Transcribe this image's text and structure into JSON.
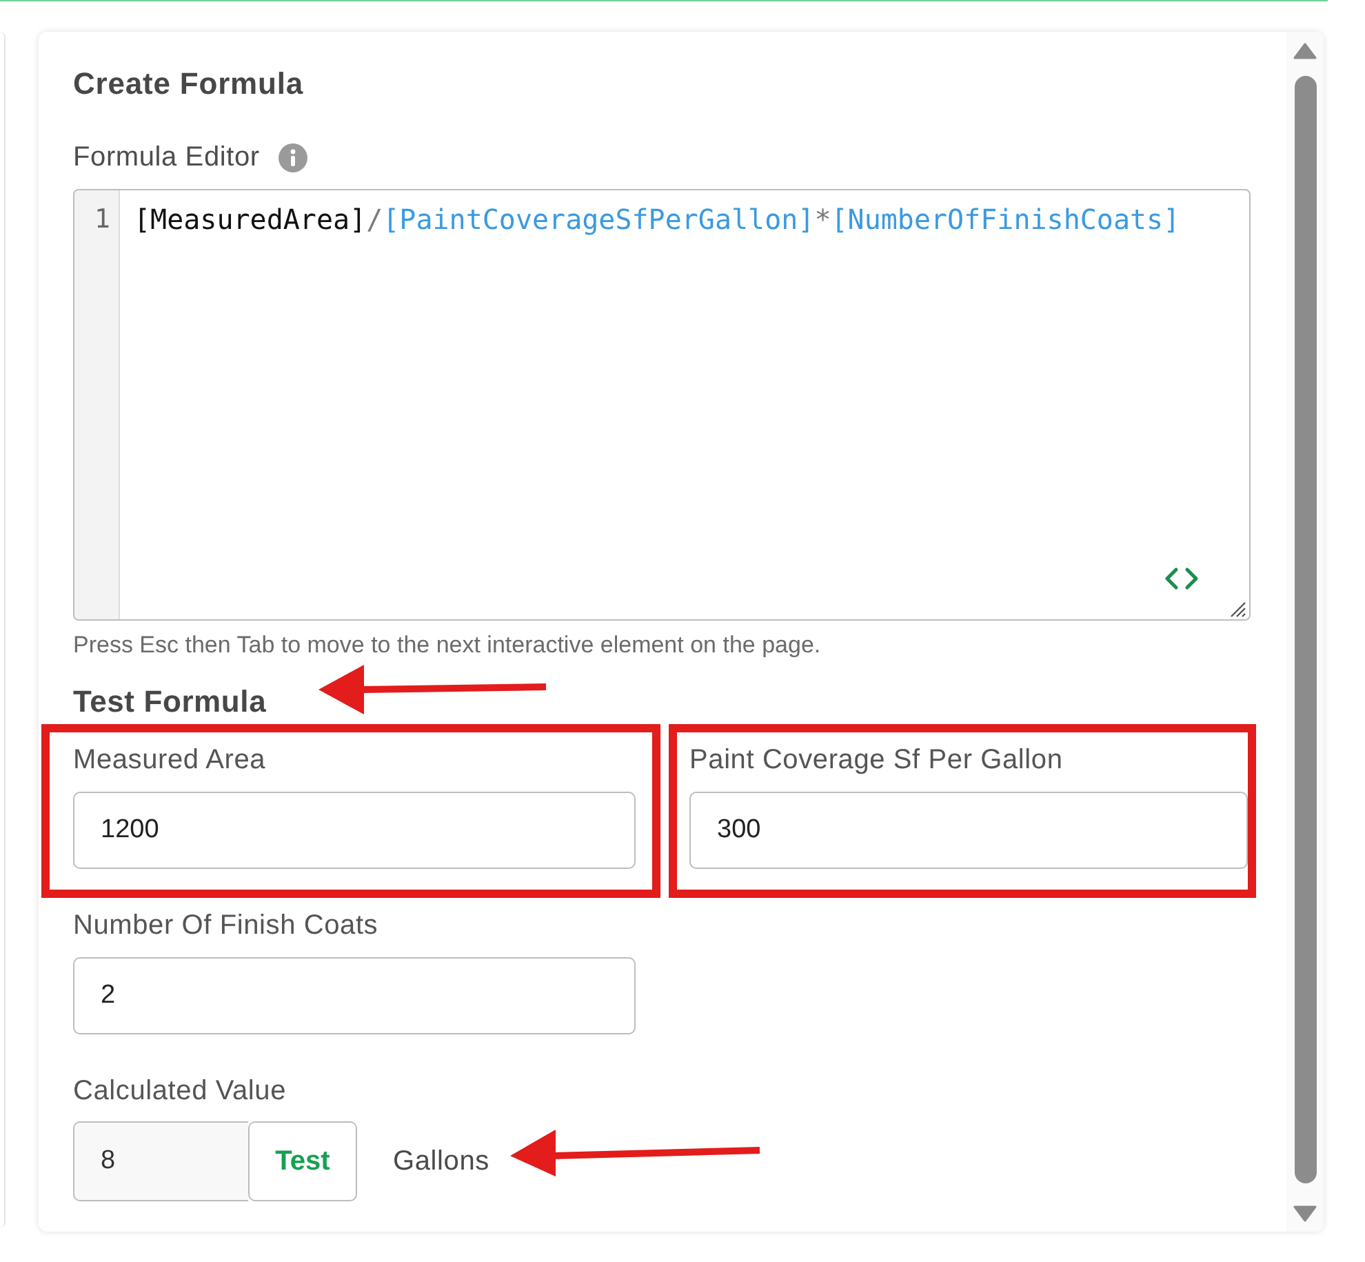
{
  "heading": "Create Formula",
  "formula_editor": {
    "label": "Formula Editor",
    "line_number": "1",
    "tokens": [
      {
        "text": "[MeasuredArea]",
        "kind": "variable"
      },
      {
        "text": "/",
        "kind": "operator"
      },
      {
        "text": "[PaintCoverageSfPerGallon]",
        "kind": "reference"
      },
      {
        "text": "*",
        "kind": "operator"
      },
      {
        "text": "[NumberOfFinishCoats]",
        "kind": "reference"
      }
    ],
    "help_text": "Press Esc then Tab to move to the next interactive element on the page."
  },
  "test_formula": {
    "title": "Test Formula",
    "title_arrow": true,
    "fields": [
      {
        "label": "Measured Area",
        "value": "1200",
        "outlined": true
      },
      {
        "label": "Paint Coverage Sf Per Gallon",
        "value": "300",
        "outlined": true
      },
      {
        "label": "Number Of Finish Coats",
        "value": "2",
        "outlined": false
      }
    ],
    "calculated": {
      "label": "Calculated Value",
      "value": "8",
      "button": "Test",
      "unit": "Gallons",
      "unit_arrow": true
    }
  }
}
